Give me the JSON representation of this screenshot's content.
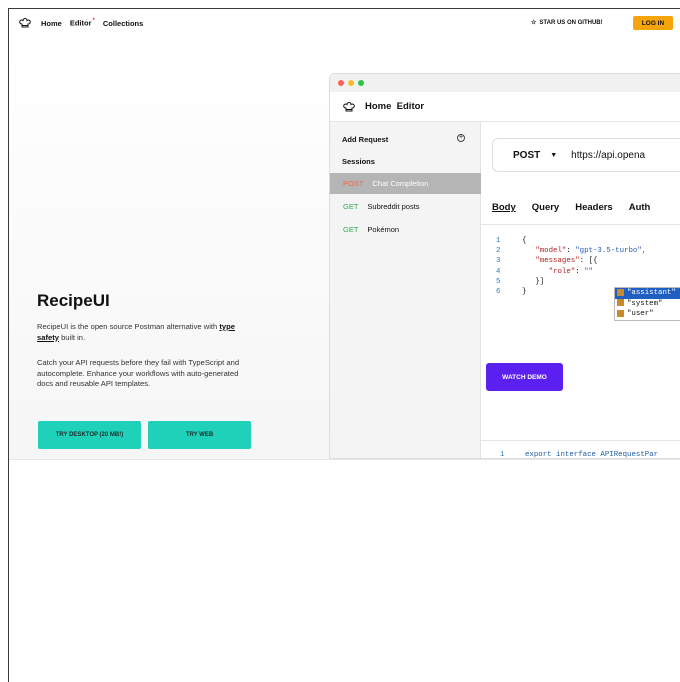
{
  "nav": {
    "logo_icon": "chef-hat-icon",
    "home": "Home",
    "editor": "Editor",
    "editor_badge": "*",
    "collections": "Collections",
    "star": "STAR US ON GITHUB!",
    "login": "LOG IN"
  },
  "hero": {
    "title": "RecipeUI",
    "p1_pre": "RecipeUI is the open source Postman alternative with ",
    "p1_link": "type safety",
    "p1_post": " built in.",
    "p2": "Catch your API requests before they fail with TypeScript and autocomplete. Enhance your workflows with auto-generated docs and reusable API templates.",
    "btn_desktop": "TRY DESKTOP (20 MB!)",
    "btn_web": "TRY WEB"
  },
  "app": {
    "title": "Home  Editor",
    "add_request": "Add Request",
    "sessions": "Sessions",
    "items": [
      {
        "method": "POST",
        "label": "Chat Completion"
      },
      {
        "method": "GET",
        "label": "Subreddit posts"
      },
      {
        "method": "GET",
        "label": "Pokémon"
      }
    ],
    "method": "POST",
    "url": "https://api.opena",
    "tabs": [
      "Body",
      "Query",
      "Headers",
      "Auth"
    ],
    "code": {
      "l1": "{",
      "k2": "\"model\"",
      "v2": "\"gpt-3.5-turbo\",",
      "k3": "\"messages\"",
      "v3": "[{",
      "k4": "\"role\"",
      "v4": "\"\"",
      "l5": "}]",
      "l6": "}"
    },
    "autocomplete": [
      "\"assistant\"",
      "\"system\"",
      "\"user\""
    ],
    "watch_demo": "WATCH DEMO",
    "bottom_code": "export interface APIRequestPar"
  },
  "colors": {
    "accent": "#1ed1b8",
    "login": "#f5a40b",
    "watch": "#5b1ff0"
  }
}
